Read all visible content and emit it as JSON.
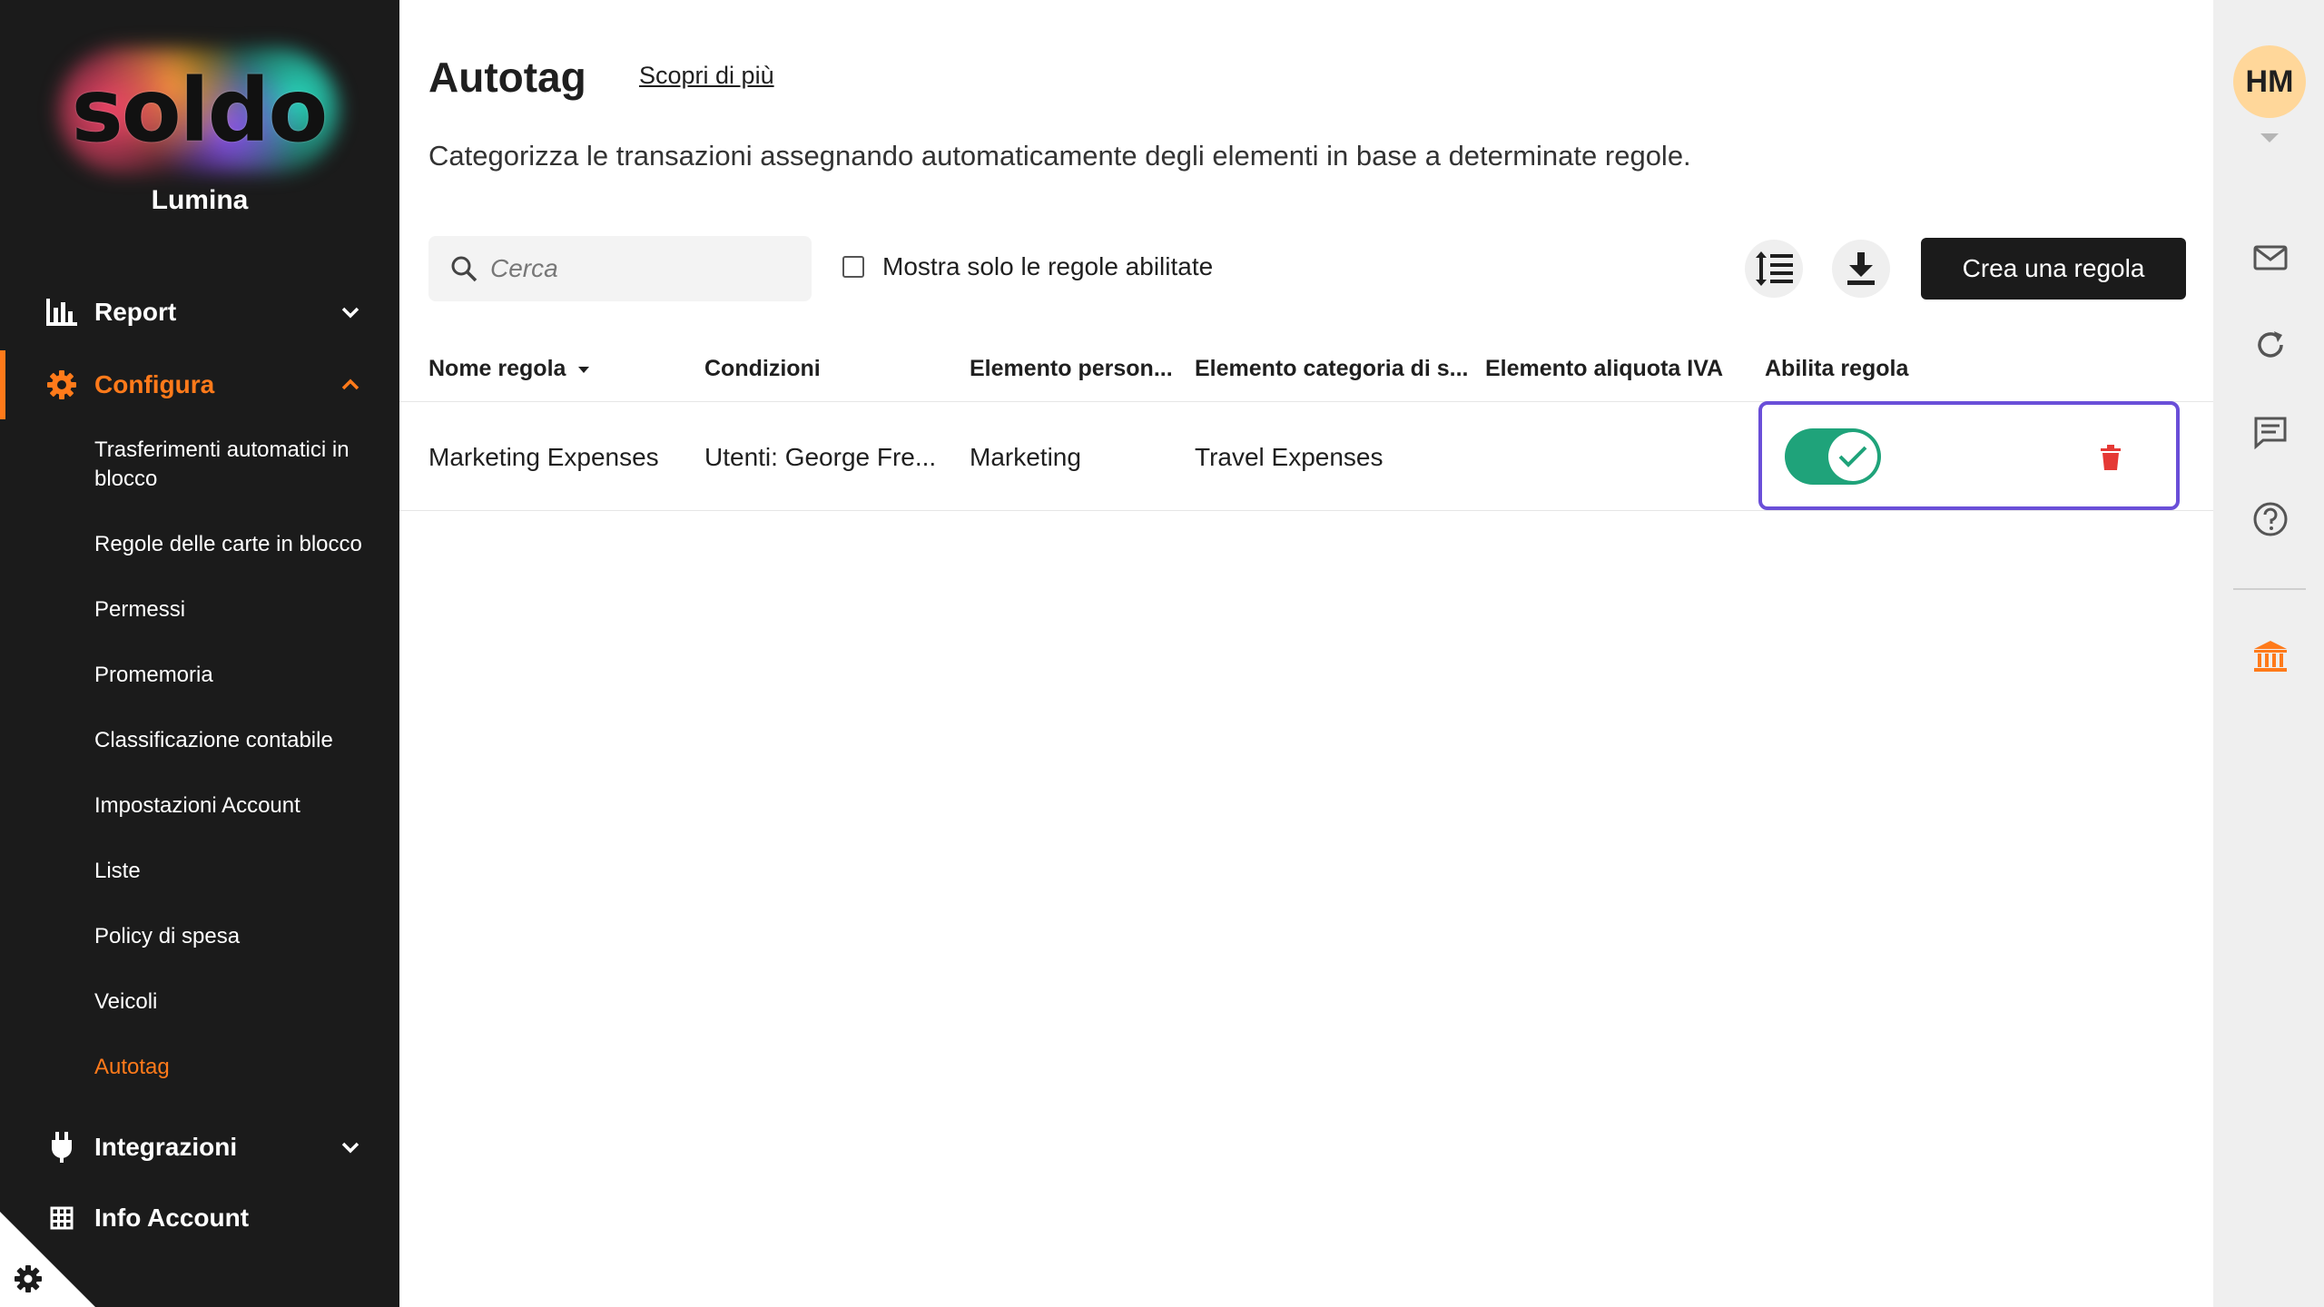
{
  "sidebar": {
    "logo_text": "soldo",
    "company": "Lumina",
    "items": [
      {
        "label": "Report",
        "icon": "bar-chart-icon"
      },
      {
        "label": "Configura",
        "icon": "gear-icon",
        "active": true
      },
      {
        "label": "Integrazioni",
        "icon": "plug-icon"
      },
      {
        "label": "Info Account",
        "icon": "grid-icon"
      }
    ],
    "configura_sub": [
      "Trasferimenti automatici in blocco",
      "Regole delle carte in blocco",
      "Permessi",
      "Promemoria",
      "Classificazione contabile",
      "Impostazioni Account",
      "Liste",
      "Policy di spesa",
      "Veicoli",
      "Autotag"
    ],
    "accent_color": "#ff7a1a"
  },
  "page": {
    "title": "Autotag",
    "learn_more": "Scopri di più",
    "description": "Categorizza le transazioni assegnando automaticamente degli elementi in base a determinate regole."
  },
  "toolbar": {
    "search_placeholder": "Cerca",
    "filter_label": "Mostra solo le regole abilitate",
    "create_label": "Crea una regola"
  },
  "table": {
    "columns": [
      "Nome regola",
      "Condizioni",
      "Elemento person...",
      "Elemento categoria di s...",
      "Elemento aliquota IVA",
      "Abilita regola"
    ],
    "rows": [
      {
        "name": "Marketing Expenses",
        "conditions": "Utenti: George Fre...",
        "custom_element": "Marketing",
        "category_element": "Travel Expenses",
        "vat_element": "",
        "enabled": true
      }
    ]
  },
  "rail": {
    "avatar_initials": "HM",
    "icons": [
      "mail-icon",
      "refresh-icon",
      "chat-icon",
      "help-icon",
      "bank-icon"
    ]
  },
  "colors": {
    "toggle_on": "#1fa37a",
    "highlight": "#6a4fd8",
    "delete": "#e53935",
    "avatar_bg": "#ffd79a"
  }
}
